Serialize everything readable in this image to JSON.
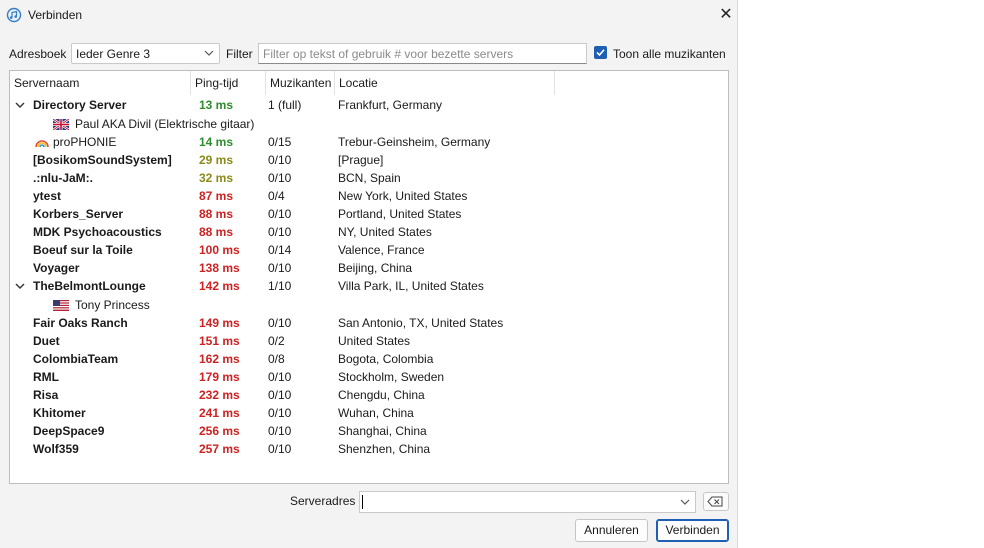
{
  "window": {
    "title": "Verbinden"
  },
  "toolbar": {
    "directory_label": "Adresboek",
    "directory_value": "Ieder Genre 3",
    "filter_label": "Filter",
    "filter_placeholder": "Filter op tekst of gebruik # voor bezette servers",
    "filter_value": "",
    "show_all_label": "Toon alle muzikanten",
    "show_all_checked": true
  },
  "columns": [
    "Servernaam",
    "Ping-tijd",
    "Muzikanten",
    "Locatie"
  ],
  "servers": [
    {
      "name": "Directory Server",
      "ping": "13 ms",
      "ping_color": "#2e8b2e",
      "musicians": "1 (full)",
      "location": "Frankfurt, Germany",
      "expanded": true,
      "clients": [
        {
          "name": "Paul AKA Divil (Elektrische gitaar)",
          "flag": "uk-flag-icon"
        }
      ]
    },
    {
      "name": "proPHONIE",
      "ping": "14 ms",
      "ping_color": "#2e8b2e",
      "musicians": "0/15",
      "location": "Trebur-Geinsheim, Germany",
      "bold": false,
      "icon": "rainbow-icon"
    },
    {
      "name": "[BosikomSoundSystem]",
      "ping": "29 ms",
      "ping_color": "#8a8a1a",
      "musicians": "0/10",
      "location": "[Prague]"
    },
    {
      "name": ".:nlu-JaM:.",
      "ping": "32 ms",
      "ping_color": "#8a8a1a",
      "musicians": "0/10",
      "location": "BCN, Spain"
    },
    {
      "name": "ytest",
      "ping": "87 ms",
      "ping_color": "#cc2222",
      "musicians": "0/4",
      "location": "New York, United States"
    },
    {
      "name": "Korbers_Server",
      "ping": "88 ms",
      "ping_color": "#cc2222",
      "musicians": "0/10",
      "location": "Portland, United States"
    },
    {
      "name": "MDK Psychoacoustics",
      "ping": "88 ms",
      "ping_color": "#cc2222",
      "musicians": "0/10",
      "location": "NY, United States"
    },
    {
      "name": "Boeuf sur la Toile",
      "ping": "100 ms",
      "ping_color": "#cc2222",
      "musicians": "0/14",
      "location": "Valence, France"
    },
    {
      "name": "Voyager",
      "ping": "138 ms",
      "ping_color": "#cc2222",
      "musicians": "0/10",
      "location": "Beijing, China"
    },
    {
      "name": "TheBelmontLounge",
      "ping": "142 ms",
      "ping_color": "#cc2222",
      "musicians": "1/10",
      "location": "Villa Park, IL, United States",
      "expanded": true,
      "clients": [
        {
          "name": "Tony Princess",
          "flag": "us-flag-icon"
        }
      ]
    },
    {
      "name": "Fair Oaks Ranch",
      "ping": "149 ms",
      "ping_color": "#cc2222",
      "musicians": "0/10",
      "location": "San Antonio, TX, United States"
    },
    {
      "name": "Duet",
      "ping": "151 ms",
      "ping_color": "#cc2222",
      "musicians": "0/2",
      "location": "United States"
    },
    {
      "name": "ColombiaTeam",
      "ping": "162 ms",
      "ping_color": "#cc2222",
      "musicians": "0/8",
      "location": "Bogota, Colombia"
    },
    {
      "name": "RML",
      "ping": "179 ms",
      "ping_color": "#cc2222",
      "musicians": "0/10",
      "location": "Stockholm, Sweden"
    },
    {
      "name": "Risa",
      "ping": "232 ms",
      "ping_color": "#cc2222",
      "musicians": "0/10",
      "location": "Chengdu, China"
    },
    {
      "name": "Khitomer",
      "ping": "241 ms",
      "ping_color": "#cc2222",
      "musicians": "0/10",
      "location": "Wuhan, China"
    },
    {
      "name": "DeepSpace9",
      "ping": "256 ms",
      "ping_color": "#cc2222",
      "musicians": "0/10",
      "location": "Shanghai, China"
    },
    {
      "name": "Wolf359",
      "ping": "257 ms",
      "ping_color": "#cc2222",
      "musicians": "0/10",
      "location": "Shenzhen, China"
    }
  ],
  "footer": {
    "server_address_label": "Serveradres",
    "server_address_value": "",
    "cancel_label": "Annuleren",
    "connect_label": "Verbinden"
  },
  "colors": {
    "accent": "#1e5fb4"
  }
}
